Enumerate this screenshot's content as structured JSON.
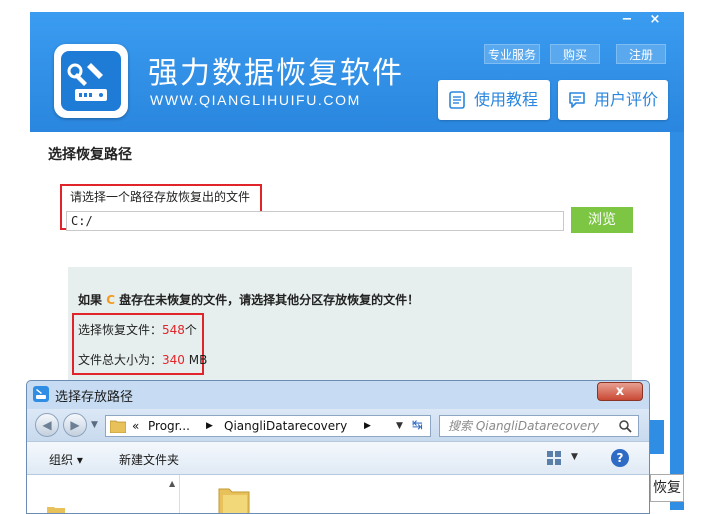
{
  "window_controls": {
    "minimize": "−",
    "close": "×"
  },
  "header": {
    "title": "强力数据恢复软件",
    "url": "WWW.QIANGLIHUIFU.COM",
    "buttons": {
      "service": "专业服务",
      "buy": "购买",
      "register": "注册"
    },
    "tutorial_label": "使用教程",
    "review_label": "用户评价"
  },
  "panel": {
    "section_title": "选择恢复路径",
    "prompt": "请选择一个路径存放恢复出的文件",
    "path_value": "C:/",
    "browse_label": "浏览",
    "warning_pre": "如果 ",
    "warning_drive": "C",
    "warning_post": " 盘存在未恢复的文件，请选择其他分区存放恢复的文件！",
    "files_label": "选择恢复文件：",
    "files_count": "548",
    "files_unit": "个",
    "size_label": "文件总大小为：",
    "size_value": "340",
    "size_unit": " MB"
  },
  "dialog": {
    "title": "选择存放路径",
    "close": "x",
    "address": {
      "prefix": "«",
      "segment1": "Progr...",
      "segment2": "QiangliDatarecovery"
    },
    "search_placeholder": "搜索 QiangliDatarecovery",
    "toolbar": {
      "organize": "组织 ▾",
      "new_folder": "新建文件夹"
    }
  },
  "background_fragment": {
    "text": "恢复"
  },
  "colors": {
    "header_blue": "#2f8de4",
    "highlight_red": "#e0242a",
    "browse_green": "#7cc644",
    "drive_orange": "#f39a1f"
  }
}
